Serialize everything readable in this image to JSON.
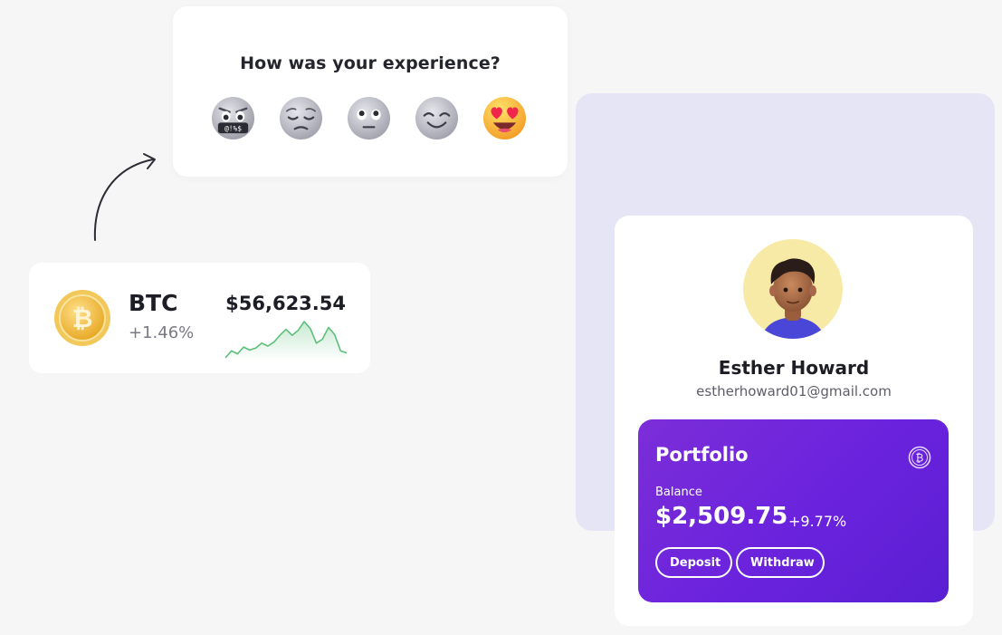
{
  "feedback": {
    "question": "How was your experience?",
    "options": [
      {
        "icon": "swearing-face-icon",
        "label": "@!%$"
      },
      {
        "icon": "pensive-face-icon"
      },
      {
        "icon": "neutral-face-icon"
      },
      {
        "icon": "smiling-face-icon"
      },
      {
        "icon": "heart-eyes-face-icon"
      }
    ]
  },
  "btc": {
    "symbol": "BTC",
    "change": "+1.46%",
    "price": "$56,623.54",
    "sparkline_color": "#5cbf7a",
    "sparkline": [
      3,
      10,
      7,
      14,
      11,
      13,
      18,
      15,
      19,
      26,
      32,
      26,
      31,
      40,
      33,
      18,
      22,
      34,
      27,
      10,
      8
    ]
  },
  "profile": {
    "name": "Esther Howard",
    "email": "estherhoward01@gmail.com",
    "avatar_bg": "#f7eaa6"
  },
  "portfolio": {
    "title": "Portfolio",
    "balance_label": "Balance",
    "balance": "$2,509.75",
    "change": "+9.77%",
    "deposit_label": "Deposit",
    "withdraw_label": "Withdraw"
  },
  "colors": {
    "background": "#f6f6f6",
    "lavender": "#e6e5f6",
    "portfolio_gradient_start": "#7b2ed8",
    "portfolio_gradient_end": "#5a1fd2",
    "btc_gold": "#f2bd34"
  }
}
